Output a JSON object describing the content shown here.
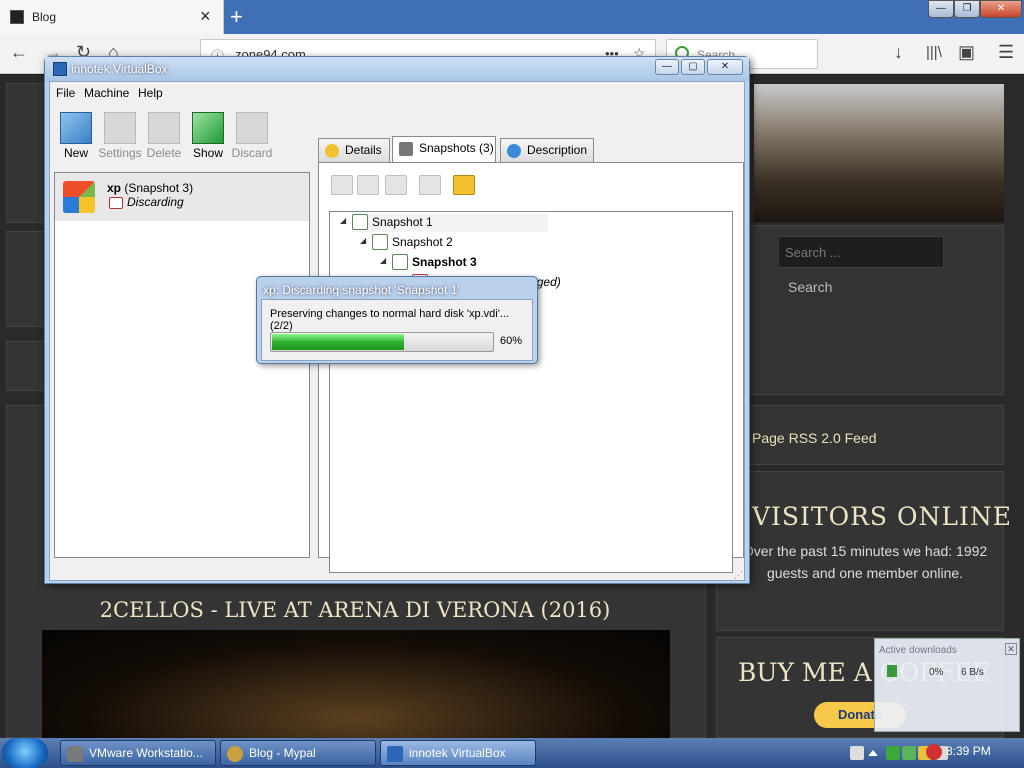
{
  "browser": {
    "tab_title": "Blog",
    "tab_close": "×",
    "new_tab": "+",
    "url": "zone94.com",
    "search_placeholder": "Search",
    "window_controls": {
      "minimize": "—",
      "restore": "❐",
      "close": "✕"
    }
  },
  "website": {
    "search_placeholder": "Search ...",
    "search_button": "Search",
    "rss_link": "Page RSS 2.0 Feed",
    "visitors_title": "VISITORS ONLINE",
    "visitors_text": "Over the past 15 minutes we had: 1992 guests and one member online.",
    "post_title": "2CELLOS - LIVE AT ARENA DI VERONA (2016)",
    "coffee_title": "BUY ME A COFFEE",
    "donate_button": "Donate",
    "downloads_panel": {
      "title": "Active downloads",
      "percent": "0%",
      "speed": "6 B/s"
    }
  },
  "vbox": {
    "title": "innotek VirtualBox",
    "menu": [
      "File",
      "Machine",
      "Help"
    ],
    "toolbar": [
      {
        "label": "New",
        "enabled": true
      },
      {
        "label": "Settings",
        "enabled": false
      },
      {
        "label": "Delete",
        "enabled": false
      },
      {
        "label": "Show",
        "enabled": true
      },
      {
        "label": "Discard",
        "enabled": false
      }
    ],
    "vm": {
      "name": "xp",
      "snapshot": "(Snapshot 3)",
      "state": "Discarding"
    },
    "tabs": [
      {
        "label": "Details",
        "active": false
      },
      {
        "label": "Snapshots (3)",
        "active": true
      },
      {
        "label": "Description",
        "active": false
      }
    ],
    "tree": [
      {
        "label": "Snapshot 1",
        "level": 0,
        "bold": false
      },
      {
        "label": "Snapshot 2",
        "level": 1,
        "bold": false
      },
      {
        "label": "Snapshot 3",
        "level": 2,
        "bold": true
      },
      {
        "label": "Current State (changed)",
        "level": 3,
        "bold": false
      }
    ]
  },
  "progress_dialog": {
    "title": "xp: Discarding snapshot 'Snapshot 1'",
    "message": "Preserving changes to normal hard disk 'xp.vdi'... (2/2)",
    "percent_label": "60%",
    "progress": 0.6
  },
  "taskbar": {
    "tasks": [
      {
        "label": "VMware Workstatio...",
        "active": false
      },
      {
        "label": "Blog - Mypal",
        "active": false
      },
      {
        "label": "innotek VirtualBox",
        "active": true
      }
    ],
    "clock": "8:39 PM"
  }
}
